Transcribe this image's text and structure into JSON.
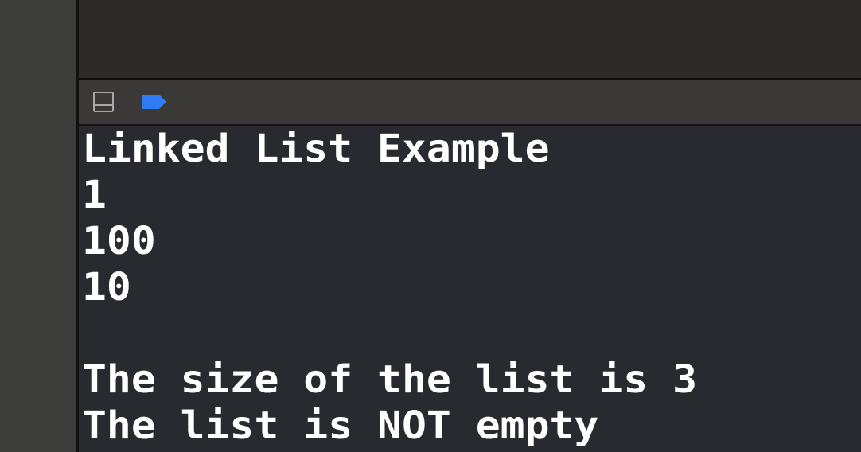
{
  "console": {
    "lines": [
      "Linked List Example",
      "1",
      "100",
      "10",
      "",
      "The size of the list is 3",
      "The list is NOT empty"
    ]
  },
  "debug_bar": {
    "icons": [
      "hide-debug-area-icon",
      "breakpoint-icon"
    ]
  },
  "colors": {
    "console_bg": "#292a30",
    "console_text": "#ffffff",
    "debug_bar_bg": "#3a3937",
    "gutter_bg": "#3c3c3b",
    "editor_bg": "#2b2a28",
    "breakpoint_accent": "#2f7bf5"
  }
}
